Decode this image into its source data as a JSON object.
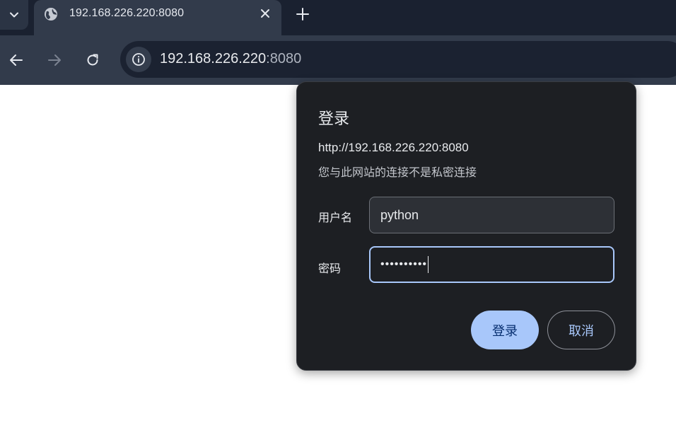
{
  "browser": {
    "tab": {
      "title": "192.168.226.220:8080",
      "icon": "globe-icon"
    },
    "omnibox": {
      "host": "192.168.226.220",
      "port": ":8080"
    }
  },
  "auth_dialog": {
    "title": "登录",
    "origin": "http://192.168.226.220:8080",
    "warning": "您与此网站的连接不是私密连接",
    "username_label": "用户名",
    "username_value": "python",
    "password_label": "密码",
    "password_value": "••••••••••",
    "ok_label": "登录",
    "cancel_label": "取消"
  },
  "colors": {
    "accent": "#a8c7fa",
    "dialog_bg": "#1d1f23",
    "toolbar_bg": "#323b4b",
    "tabbar_bg": "#1a2130"
  }
}
